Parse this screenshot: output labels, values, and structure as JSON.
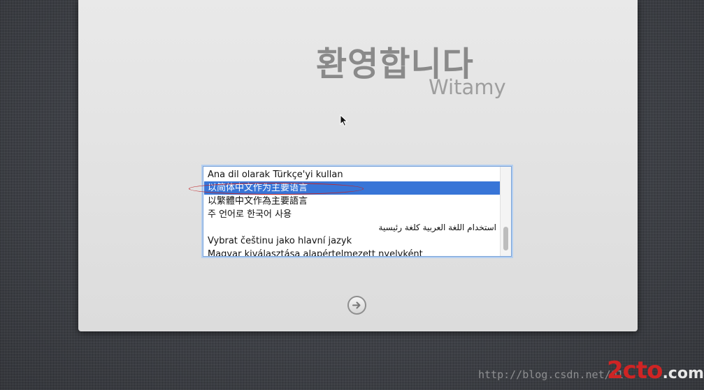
{
  "welcome": {
    "title": "환영합니다",
    "subtitle": "Witamy"
  },
  "language_list": {
    "items": [
      {
        "label": "Ana dil olarak Türkçe'yi kullan",
        "selected": false
      },
      {
        "label": "以简体中文作为主要语言",
        "selected": true
      },
      {
        "label": "以繁體中文作為主要語言",
        "selected": false
      },
      {
        "label": "주 언어로 한국어 사용",
        "selected": false
      },
      {
        "label": "استخدام اللغة العربية كلغة رئيسية",
        "selected": false,
        "rtl": true
      },
      {
        "label": "Vybrat češtinu jako hlavní jazyk",
        "selected": false
      },
      {
        "label": "Magyar kiválasztása alapértelmezett nyelvként",
        "selected": false
      }
    ],
    "selection_color": "#3875d7"
  },
  "next_button": {
    "icon": "arrow-right-circle-icon"
  },
  "annotation": {
    "color": "#c0262b"
  },
  "watermark": {
    "url": "http://blog.csdn.net/01",
    "logo": "2cto",
    "logo_suffix": ".com"
  }
}
